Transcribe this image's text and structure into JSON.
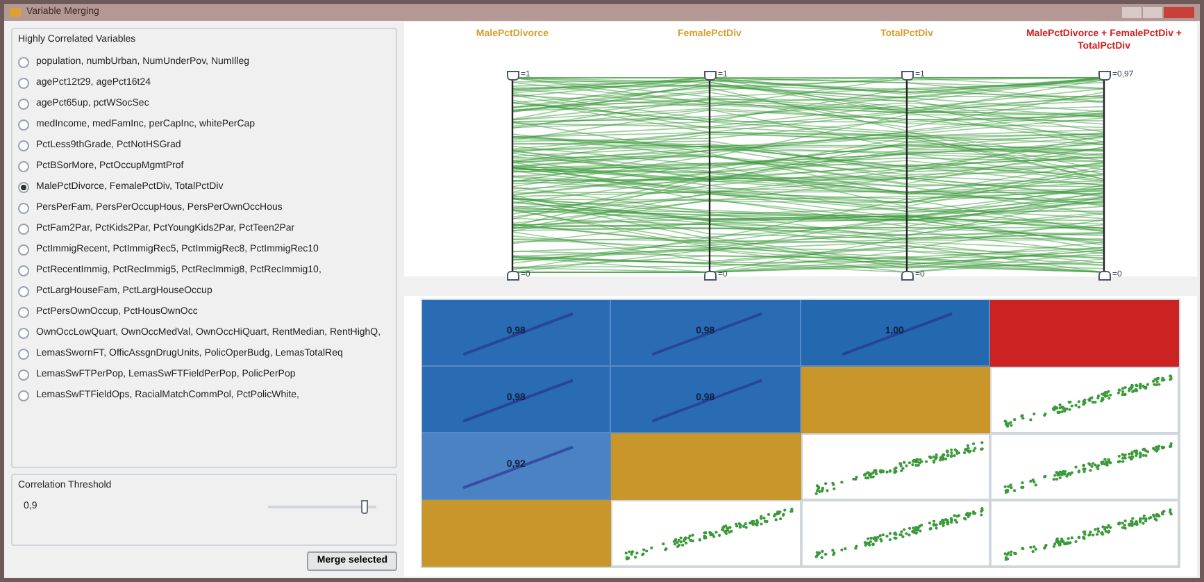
{
  "window": {
    "title": "Variable Merging"
  },
  "groups": {
    "title": "Highly Correlated Variables",
    "items": [
      {
        "label": "population,  numbUrban,  NumUnderPov,  NumIlleg",
        "selected": false
      },
      {
        "label": "agePct12t29,  agePct16t24",
        "selected": false
      },
      {
        "label": "agePct65up,  pctWSocSec",
        "selected": false
      },
      {
        "label": "medIncome,  medFamInc,  perCapInc,  whitePerCap",
        "selected": false
      },
      {
        "label": "PctLess9thGrade,  PctNotHSGrad",
        "selected": false
      },
      {
        "label": "PctBSorMore,  PctOccupMgmtProf",
        "selected": false
      },
      {
        "label": "MalePctDivorce,  FemalePctDiv,  TotalPctDiv",
        "selected": true
      },
      {
        "label": "PersPerFam,  PersPerOccupHous,  PersPerOwnOccHous",
        "selected": false
      },
      {
        "label": "PctFam2Par,  PctKids2Par,  PctYoungKids2Par,  PctTeen2Par",
        "selected": false
      },
      {
        "label": "PctImmigRecent,  PctImmigRec5,  PctImmigRec8,  PctImmigRec10",
        "selected": false
      },
      {
        "label": "PctRecentImmig,  PctRecImmig5,  PctRecImmig8,  PctRecImmig10,",
        "selected": false
      },
      {
        "label": "PctLargHouseFam,  PctLargHouseOccup",
        "selected": false
      },
      {
        "label": "PctPersOwnOccup,  PctHousOwnOcc",
        "selected": false
      },
      {
        "label": "OwnOccLowQuart,  OwnOccMedVal,  OwnOccHiQuart,  RentMedian,  RentHighQ,",
        "selected": false
      },
      {
        "label": "LemasSwornFT,  OfficAssgnDrugUnits,  PolicOperBudg,  LemasTotalReq",
        "selected": false
      },
      {
        "label": "LemasSwFTPerPop,  LemasSwFTFieldPerPop,  PolicPerPop",
        "selected": false
      },
      {
        "label": "LemasSwFTFieldOps,  RacialMatchCommPol,  PctPolicWhite,",
        "selected": false
      }
    ]
  },
  "threshold": {
    "title": "Correlation Threshold",
    "value": "0,9",
    "level": 0.9
  },
  "merge_button": "Merge selected",
  "parallel_axes": [
    {
      "label": "MalePctDivorce",
      "color": "#d4a030",
      "max": "=1",
      "min": "=0"
    },
    {
      "label": "FemalePctDiv",
      "color": "#d4a030",
      "max": "=1",
      "min": "=0"
    },
    {
      "label": "TotalPctDiv",
      "color": "#d4a030",
      "max": "=1",
      "min": "=0"
    },
    {
      "label": "MalePctDivorce  +  FemalePctDiv  +  TotalPctDiv",
      "color": "#d42020",
      "max": "=0,97",
      "min": "=0"
    }
  ],
  "matrix": [
    [
      {
        "kind": "correlation",
        "value": "0,98",
        "color": "#2a6cb4"
      },
      {
        "kind": "correlation",
        "value": "0,98",
        "color": "#2a6cb4"
      },
      {
        "kind": "correlation",
        "value": "1,00",
        "color": "#2468b0"
      },
      {
        "kind": "solid",
        "color": "#cc2222"
      }
    ],
    [
      {
        "kind": "correlation",
        "value": "0,98",
        "color": "#2a6cb4"
      },
      {
        "kind": "correlation",
        "value": "0,98",
        "color": "#2a6cb4"
      },
      {
        "kind": "solid",
        "color": "#c9962c"
      },
      {
        "kind": "scatter"
      }
    ],
    [
      {
        "kind": "correlation",
        "value": "0,92",
        "color": "#4a82c4"
      },
      {
        "kind": "solid",
        "color": "#c9962c"
      },
      {
        "kind": "scatter"
      },
      {
        "kind": "scatter"
      }
    ],
    [
      {
        "kind": "solid",
        "color": "#c9962c"
      },
      {
        "kind": "scatter"
      },
      {
        "kind": "scatter"
      },
      {
        "kind": "scatter"
      }
    ]
  ]
}
